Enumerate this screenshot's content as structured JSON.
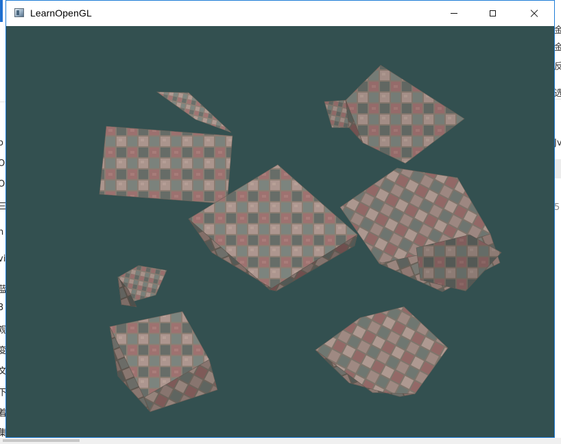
{
  "window": {
    "title": "LearnOpenGL",
    "icon": "opengl-window-icon",
    "controls": [
      "minimize-icon",
      "maximize-icon",
      "close-icon"
    ]
  },
  "viewport": {
    "clear_color": "#335050",
    "scene": "textured rotating cubes",
    "cube_texture_colors": {
      "light": "#b19a92",
      "grey": "#7f8781",
      "dark": "#6a706b",
      "red": "#a27573",
      "grout": "#8f8176"
    }
  },
  "background_fragments": {
    "left": [
      "o",
      "O",
      "O",
      "三",
      "n",
      "vi",
      "蓝",
      "3",
      "观",
      "变",
      "文",
      "下",
      "着",
      "集"
    ],
    "right": [
      "金",
      "金",
      "反",
      "选",
      "Jv",
      "5"
    ]
  },
  "colors": {
    "accent": "#1c7bd6",
    "taskbar_tab": "#1e6fd0"
  }
}
